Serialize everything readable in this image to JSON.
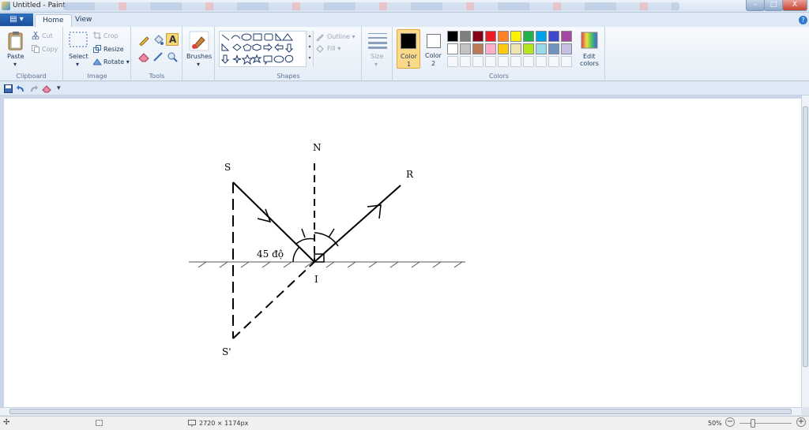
{
  "window": {
    "title": "Untitled - Paint",
    "minimize": "–",
    "maximize": "□",
    "close": "X"
  },
  "tabs": {
    "file": "▤ ▾",
    "home": "Home",
    "view": "View",
    "help": "?"
  },
  "ribbon": {
    "clipboard": {
      "paste": "Paste",
      "cut": "Cut",
      "copy": "Copy",
      "label": "Clipboard"
    },
    "image": {
      "select": "Select",
      "crop": "Crop",
      "resize": "Resize",
      "rotate": "Rotate ▾",
      "label": "Image"
    },
    "tools": {
      "label": "Tools"
    },
    "brushes": {
      "label": "Brushes"
    },
    "shapes": {
      "outline": "Outline ▾",
      "fill": "Fill ▾",
      "label": "Shapes"
    },
    "size": {
      "label": "Size"
    },
    "colors": {
      "color1": "Color",
      "color1_num": "1",
      "color2": "Color",
      "color2_num": "2",
      "edit": "Edit",
      "edit2": "colors",
      "label": "Colors",
      "palette_row1": [
        "#000000",
        "#7f7f7f",
        "#880015",
        "#ed1c24",
        "#ff7f27",
        "#fff200",
        "#22b14c",
        "#00a2e8",
        "#3f48cc",
        "#a349a4"
      ],
      "palette_row2": [
        "#ffffff",
        "#c3c3c3",
        "#b97a57",
        "#ffaec9",
        "#ffc90e",
        "#efe4b0",
        "#b5e61d",
        "#99d9ea",
        "#7092be",
        "#c8bfe7"
      ],
      "color1_value": "#000000",
      "color2_value": "#ffffff"
    }
  },
  "diagram": {
    "label_s": "S",
    "label_n": "N",
    "label_r": "R",
    "label_i": "I",
    "label_s_prime": "S'",
    "angle_label": "45 độ"
  },
  "status": {
    "dimensions": "2720 × 1174px",
    "zoom": "50%",
    "zoom_out": "−",
    "zoom_in": "+"
  }
}
